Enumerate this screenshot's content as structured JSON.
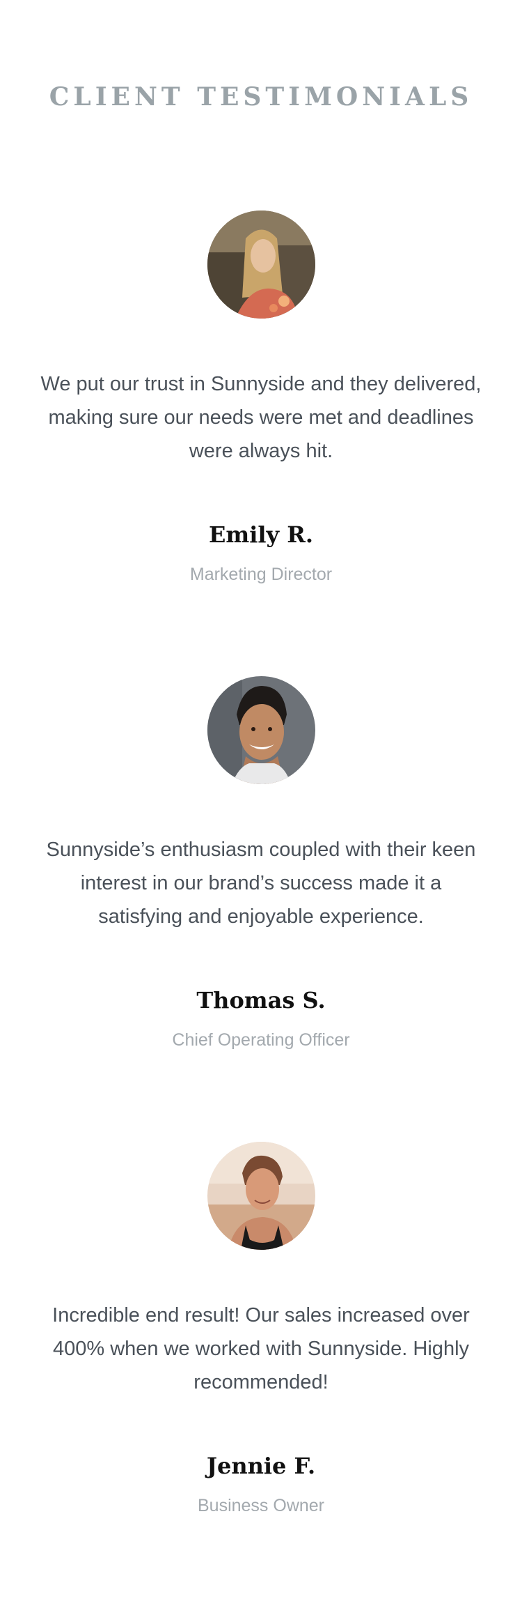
{
  "section": {
    "title": "CLIENT TESTIMONIALS"
  },
  "testimonials": [
    {
      "quote": "We put our trust in Sunnyside and they delivered, making sure our needs were met and deadlines were always hit.",
      "name": "Emily R.",
      "role": "Marketing Director"
    },
    {
      "quote": "Sunnyside’s enthusiasm coupled with their keen interest in our brand’s success made it a satisfying and enjoyable experience.",
      "name": "Thomas S.",
      "role": "Chief Operating Officer"
    },
    {
      "quote": "Incredible end result! Our sales increased over 400% when we worked with Sunnyside. Highly recommended!",
      "name": "Jennie F.",
      "role": "Business Owner"
    }
  ],
  "colors": {
    "title": "#9aa3a8",
    "quote_text": "#4a5159",
    "name_text": "#111111",
    "role_text": "#a3a9ae",
    "background": "#ffffff"
  }
}
